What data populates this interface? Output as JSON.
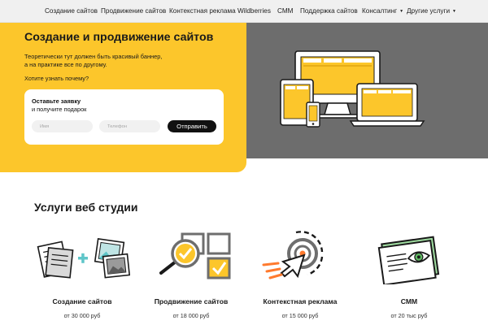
{
  "nav": {
    "items": [
      {
        "label": "Создание сайтов"
      },
      {
        "label": "Продвижение сайтов"
      },
      {
        "label": "Контекстная реклама"
      },
      {
        "label": "Wildberries"
      },
      {
        "label": "СММ"
      },
      {
        "label": "Поддержка сайтов"
      },
      {
        "label": "Консалтинг",
        "caret": "▼"
      },
      {
        "label": "Другие услуги",
        "caret": "▼"
      }
    ]
  },
  "hero": {
    "title": "Создание и продвижение сайтов",
    "text_line1": "Теоретически тут должен быть красивый баннер,",
    "text_line2": "а на практике все по другому.",
    "link": "Хотите узнать почему?",
    "form": {
      "title": "Оставьте заявку",
      "subtitle": "и получите подарок",
      "name_placeholder": "Имя",
      "phone_placeholder": "Телефон",
      "submit_label": "Отправить"
    }
  },
  "services": {
    "title": "Услуги веб студии",
    "items": [
      {
        "name": "Создание сайтов",
        "price": "от 30 000 руб",
        "icon": "documents-images-icon"
      },
      {
        "name": "Продвижение сайтов",
        "price": "от 18 000 руб",
        "icon": "magnifier-checklist-icon"
      },
      {
        "name": "Контекстная реклама",
        "price": "от 15 000 руб",
        "icon": "target-cursor-icon"
      },
      {
        "name": "СММ",
        "price": "от 20 тыс руб",
        "icon": "eye-book-icon"
      }
    ]
  },
  "colors": {
    "accent": "#fcc62b",
    "dark": "#111111",
    "gray_panel": "#6d6d6d",
    "nav_bg": "#f0f0f0"
  }
}
